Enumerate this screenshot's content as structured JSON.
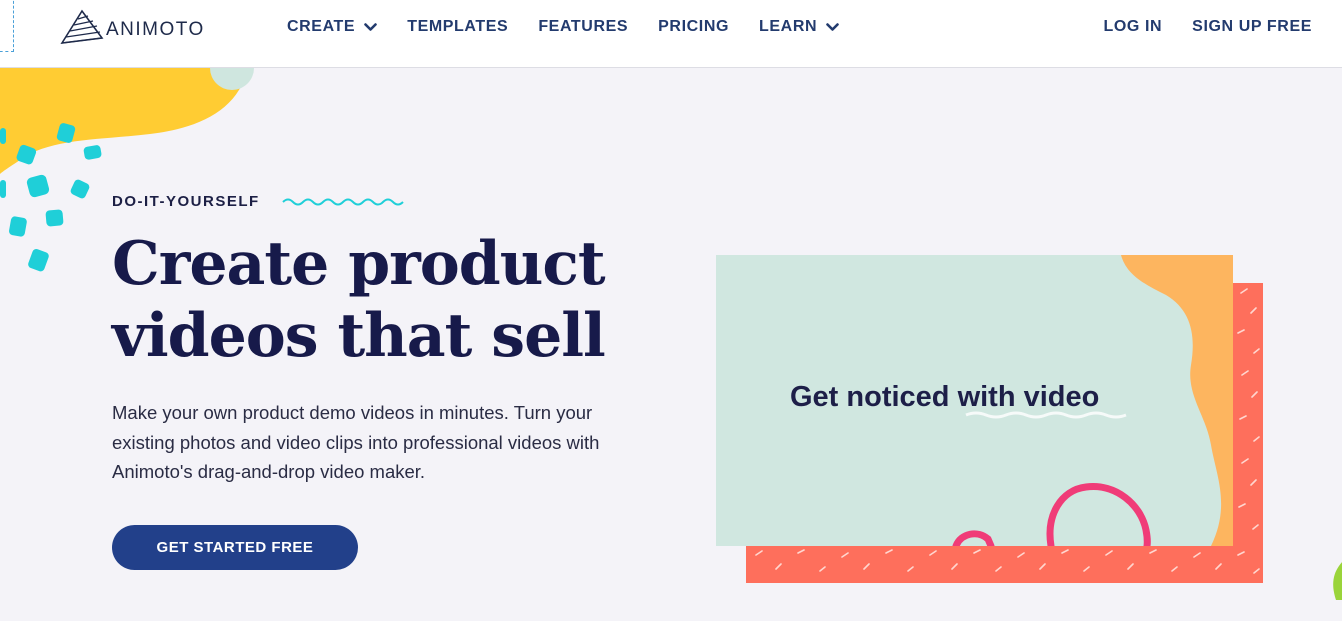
{
  "brand": {
    "name": "ANIMOTO"
  },
  "nav": {
    "items": [
      {
        "label": "CREATE",
        "has_dropdown": true
      },
      {
        "label": "TEMPLATES",
        "has_dropdown": false
      },
      {
        "label": "FEATURES",
        "has_dropdown": false
      },
      {
        "label": "PRICING",
        "has_dropdown": false
      },
      {
        "label": "LEARN",
        "has_dropdown": true
      }
    ],
    "login_label": "LOG IN",
    "signup_label": "SIGN UP FREE"
  },
  "hero": {
    "eyebrow": "DO-IT-YOURSELF",
    "headline_line1": "Create product",
    "headline_line2": "videos that sell",
    "description": "Make your own product demo videos in minutes. Turn your existing photos and video clips into professional videos with Animoto's drag-and-drop video maker.",
    "cta_label": "GET STARTED FREE"
  },
  "video_card": {
    "title": "Get noticed with video"
  },
  "colors": {
    "nav_text": "#233b6e",
    "cta_bg": "#22408a",
    "headline": "#171a4a",
    "yellow_blob": "#ffcc33",
    "teal_dots": "#1fcfd8",
    "card_bg": "#d0e7e0",
    "card_orange": "#fdb55f",
    "card_coral": "#fe6f5c",
    "pink_stroke": "#f03c78"
  }
}
